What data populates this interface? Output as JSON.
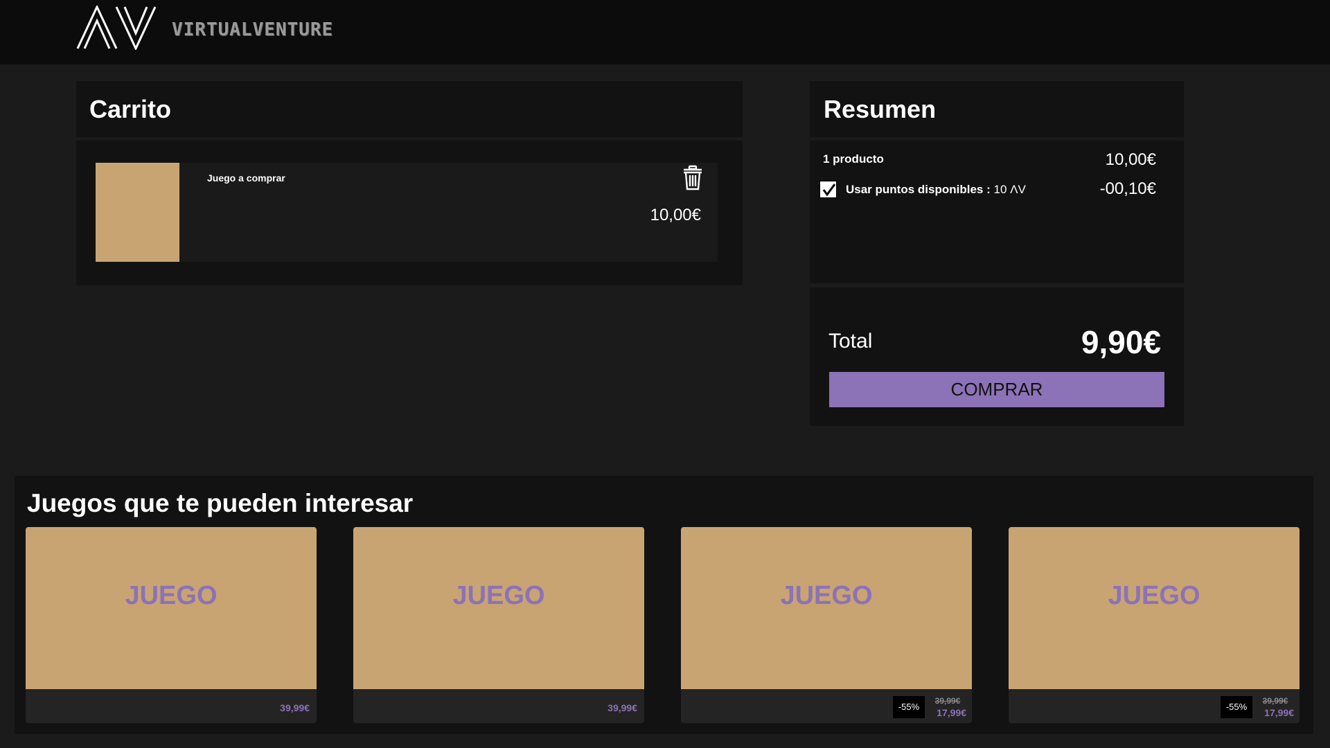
{
  "header": {
    "logo_text": "VIRTUALVENTURE",
    "logo_icon": "av-logo"
  },
  "cart": {
    "title": "Carrito",
    "item": {
      "name": "Juego a comprar",
      "price": "10,00€",
      "delete_icon": "trash-icon"
    }
  },
  "summary": {
    "title": "Resumen",
    "products_label": "1 producto",
    "products_value": "10,00€",
    "points_label": "Usar puntos disponibles :",
    "points_amount": "10 ΛV",
    "points_checked": true,
    "points_value": "-00,10€",
    "total_label": "Total",
    "total_value": "9,90€",
    "buy_label": "COMPRAR"
  },
  "recommendations": {
    "title": "Juegos que te pueden interesar",
    "cards": [
      {
        "label": "JUEGO",
        "price": "39,99€"
      },
      {
        "label": "JUEGO",
        "price": "39,99€"
      },
      {
        "label": "JUEGO",
        "discount": "-55%",
        "old_price": "39,99€",
        "new_price": "17,99€"
      },
      {
        "label": "JUEGO",
        "discount": "-55%",
        "old_price": "39,99€",
        "new_price": "17,99€"
      }
    ]
  },
  "colors": {
    "accent": "#8c72b6",
    "placeholder": "#c9a473",
    "background": "#1b1b1b",
    "panel": "#121212"
  }
}
